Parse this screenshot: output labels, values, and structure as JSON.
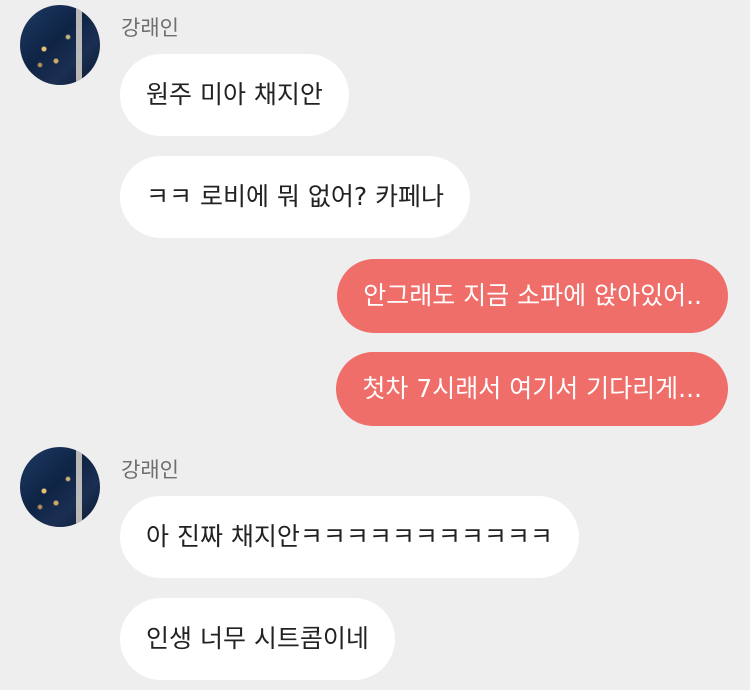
{
  "colors": {
    "background": "#eeeeee",
    "incoming_bubble": "#ffffff",
    "outgoing_bubble": "#ef6e6a"
  },
  "groups": [
    {
      "sender": "강래인",
      "messages": [
        "원주 미아 채지안",
        "ㅋㅋ 로비에 뭐 없어? 카페나"
      ]
    },
    {
      "sender": "강래인",
      "messages": [
        "아 진짜 채지안ㅋㅋㅋㅋㅋㅋㅋㅋㅋㅋㅋ",
        "인생 너무 시트콤이네"
      ]
    }
  ],
  "outgoing": [
    "안그래도 지금 소파에 앉아있어..",
    "첫차 7시래서 여기서 기다리게..."
  ]
}
